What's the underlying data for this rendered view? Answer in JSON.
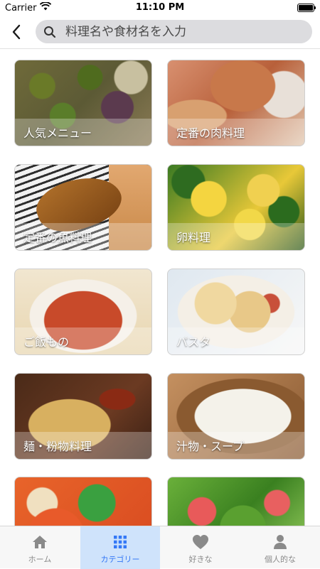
{
  "status_bar": {
    "carrier": "Carrier",
    "time": "11:10 PM",
    "wifi_icon": "wifi-icon",
    "battery_icon": "battery-icon"
  },
  "nav": {
    "back_icon": "chevron-left-icon",
    "search_icon": "magnifier-icon",
    "search_placeholder": "料理名や食材名を入力"
  },
  "categories": [
    {
      "label": "人気メニュー"
    },
    {
      "label": "定番の肉料理"
    },
    {
      "label": "定番の魚料理"
    },
    {
      "label": "卵料理"
    },
    {
      "label": "ご飯もの"
    },
    {
      "label": "パスタ"
    },
    {
      "label": "麺・粉物料理"
    },
    {
      "label": "汁物・スープ"
    },
    {
      "label": ""
    },
    {
      "label": ""
    }
  ],
  "tab_bar": {
    "active_color": "#3478f6",
    "tabs": [
      {
        "label": "ホーム",
        "icon": "home-icon"
      },
      {
        "label": "カテゴリー",
        "icon": "grid-icon"
      },
      {
        "label": "好きな",
        "icon": "heart-icon"
      },
      {
        "label": "個人的な",
        "icon": "person-icon"
      }
    ]
  }
}
